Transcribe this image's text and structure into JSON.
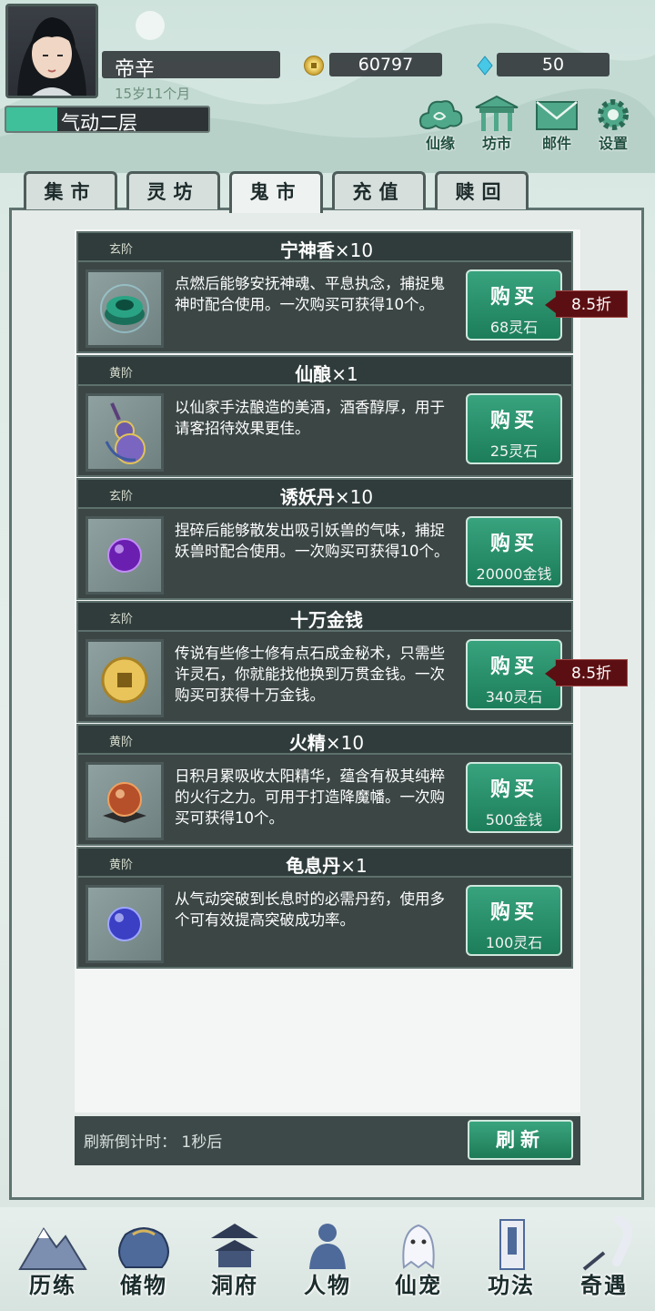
{
  "player": {
    "name": "帝辛",
    "age": "15岁11个月",
    "coins": "60797",
    "gems": "50",
    "realm": "气动二层",
    "realm_progress": 0.25
  },
  "top_buttons": [
    {
      "label": "仙缘",
      "icon": "cloud-icon"
    },
    {
      "label": "坊市",
      "icon": "pavilion-icon"
    },
    {
      "label": "邮件",
      "icon": "mail-icon"
    },
    {
      "label": "设置",
      "icon": "gear-icon"
    }
  ],
  "tabs": [
    {
      "label": "集市",
      "active": false
    },
    {
      "label": "灵坊",
      "active": false
    },
    {
      "label": "鬼市",
      "active": true
    },
    {
      "label": "充值",
      "active": false
    },
    {
      "label": "赎回",
      "active": false
    }
  ],
  "items": [
    {
      "grade": "玄阶",
      "name": "宁神香",
      "qty": "×10",
      "desc": "点燃后能够安抚神魂、平息执念，捕捉鬼神时配合使用。一次购买可获得10个。",
      "buy": "购买",
      "price": "68灵石",
      "discount": "8.5折",
      "icon": "incense-icon"
    },
    {
      "grade": "黄阶",
      "name": "仙酿",
      "qty": "×1",
      "desc": "以仙家手法酿造的美酒，酒香醇厚，用于请客招待效果更佳。",
      "buy": "购买",
      "price": "25灵石",
      "discount": "",
      "icon": "gourd-icon"
    },
    {
      "grade": "玄阶",
      "name": "诱妖丹",
      "qty": "×10",
      "desc": "捏碎后能够散发出吸引妖兽的气味，捕捉妖兽时配合使用。一次购买可获得10个。",
      "buy": "购买",
      "price": "20000金钱",
      "discount": "",
      "icon": "purple-pill-icon"
    },
    {
      "grade": "玄阶",
      "name": "十万金钱",
      "qty": "",
      "desc": "传说有些修士修有点石成金秘术，只需些许灵石，你就能找他换到万贯金钱。一次购买可获得十万金钱。",
      "buy": "购买",
      "price": "340灵石",
      "discount": "8.5折",
      "icon": "coin-icon"
    },
    {
      "grade": "黄阶",
      "name": "火精",
      "qty": "×10",
      "desc": "日积月累吸收太阳精华，蕴含有极其纯粹的火行之力。可用于打造降魔幡。一次购买可获得10个。",
      "buy": "购买",
      "price": "500金钱",
      "discount": "",
      "icon": "fire-orb-icon"
    },
    {
      "grade": "黄阶",
      "name": "龟息丹",
      "qty": "×1",
      "desc": "从气动突破到长息时的必需丹药，使用多个可有效提高突破成功率。",
      "buy": "购买",
      "price": "100灵石",
      "discount": "",
      "icon": "blue-pill-icon"
    }
  ],
  "refresh": {
    "countdown": "刷新倒计时：  1秒后",
    "button": "刷新"
  },
  "bottom_nav": [
    {
      "label": "历练",
      "icon": "mountain-icon"
    },
    {
      "label": "储物",
      "icon": "bag-icon"
    },
    {
      "label": "洞府",
      "icon": "palace-icon"
    },
    {
      "label": "人物",
      "icon": "person-icon"
    },
    {
      "label": "仙宠",
      "icon": "ghost-pet-icon"
    },
    {
      "label": "功法",
      "icon": "scroll-book-icon"
    },
    {
      "label": "奇遇",
      "icon": "brush-icon"
    }
  ],
  "colors": {
    "accent": "#2a8f6a",
    "panel_dark": "#3b4645",
    "discount": "#5c0f12"
  }
}
